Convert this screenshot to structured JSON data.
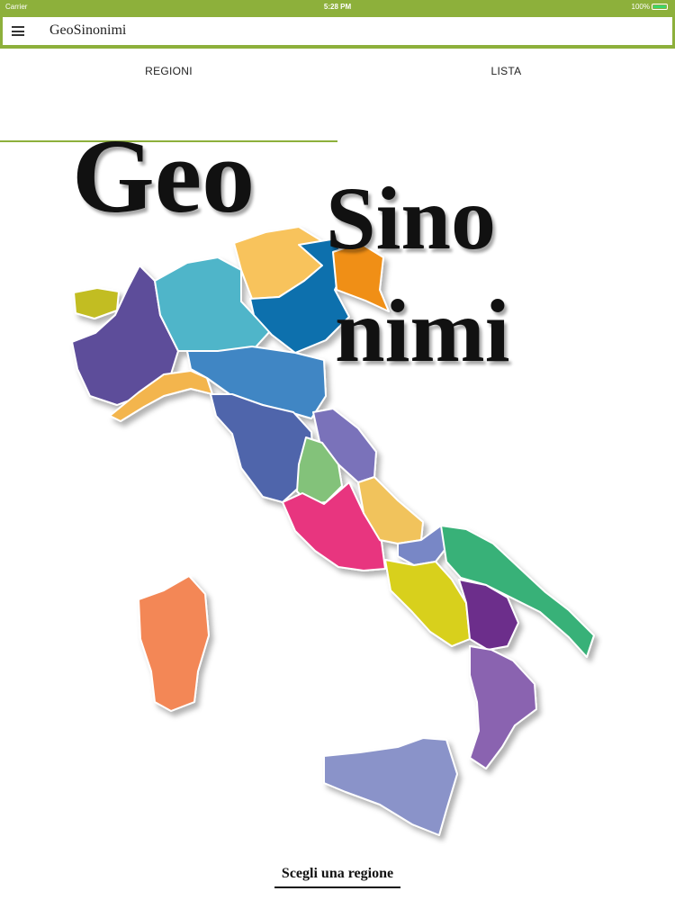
{
  "status_bar": {
    "carrier": "Carrier",
    "time": "5:28 PM",
    "battery": "100%"
  },
  "header": {
    "title": "GeoSinonimi"
  },
  "tabs": [
    {
      "label": "REGIONI",
      "active": true
    },
    {
      "label": "LISTA",
      "active": false
    }
  ],
  "logo_words": {
    "line1": "Geo",
    "line2": "Sino",
    "line3": "nimi"
  },
  "cta": {
    "label": "Scegli una regione"
  },
  "colors": {
    "accent": "#8db03b",
    "battery": "#3bd46b"
  }
}
